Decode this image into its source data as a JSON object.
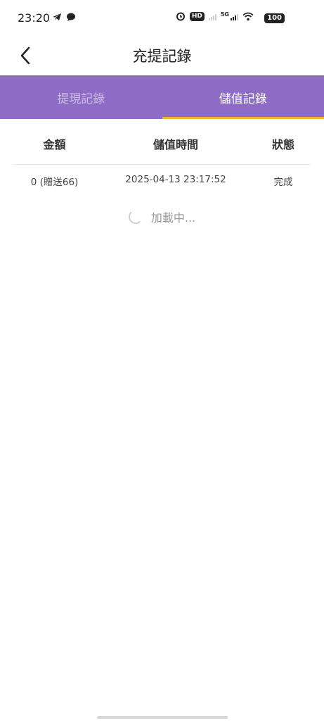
{
  "status_bar": {
    "time": "23:20",
    "hd_label": "HD",
    "network": "5G",
    "battery": "100"
  },
  "nav": {
    "title": "充提記錄",
    "back_icon": "chevron-left-icon"
  },
  "tabs": [
    {
      "label": "提現記錄",
      "active": false
    },
    {
      "label": "儲值記錄",
      "active": true
    }
  ],
  "colors": {
    "tab_bar_bg": "#8e6bc4",
    "active_underline": "#f3b52b"
  },
  "table": {
    "headers": [
      "金額",
      "儲值時間",
      "狀態"
    ],
    "rows": [
      {
        "amount": "0 (贈送66)",
        "time": "2025-04-13 23:17:52",
        "status": "完成"
      }
    ]
  },
  "loading_text": "加載中..."
}
